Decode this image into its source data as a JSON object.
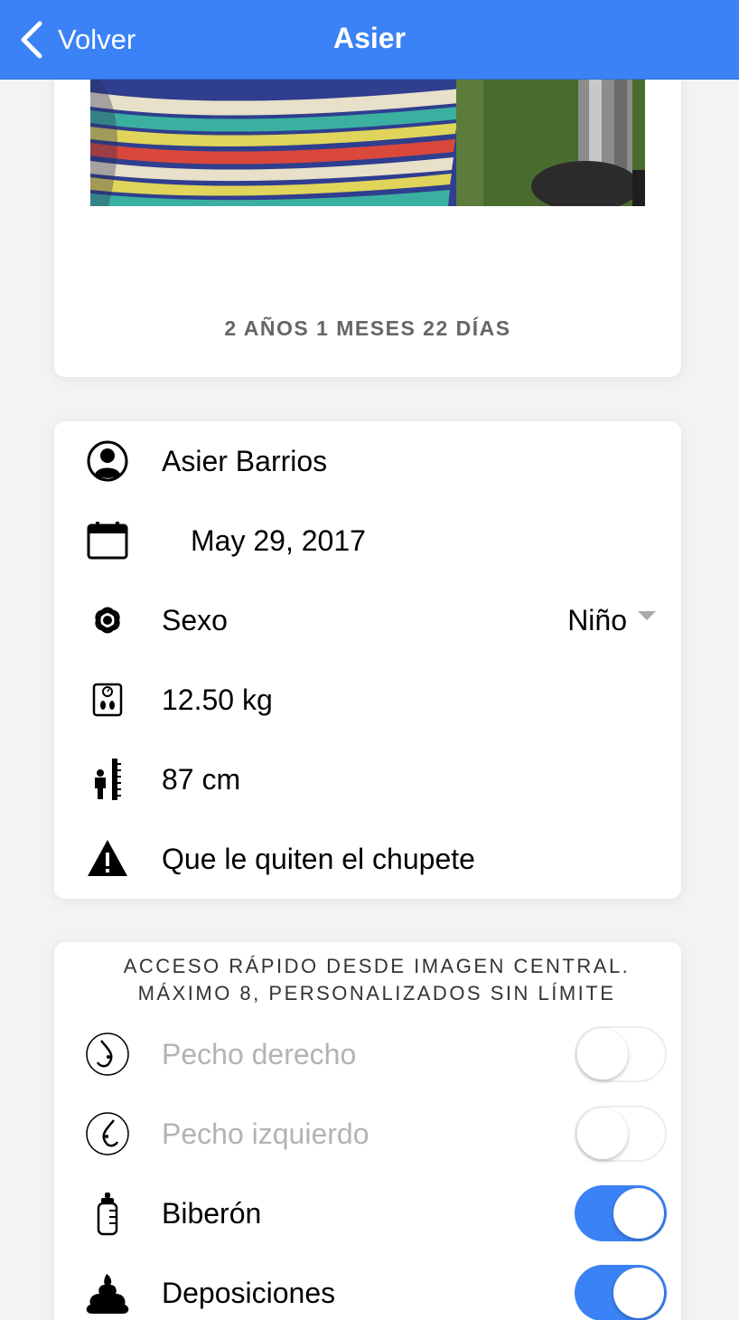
{
  "header": {
    "back_label": "Volver",
    "title": "Asier",
    "color": "#3b82f6"
  },
  "profile": {
    "age": "2 AÑOS 1 MESES 22 DÍAS"
  },
  "info": {
    "name": "Asier Barrios",
    "birthdate": "May 29, 2017",
    "sex_label": "Sexo",
    "sex_value": "Niño",
    "weight": "12.50 kg",
    "height": "87 cm",
    "note": "Que le quiten el chupete"
  },
  "quick_access": {
    "title_line1": "ACCESO RÁPIDO DESDE IMAGEN CENTRAL.",
    "title_line2": "MÁXIMO 8, PERSONALIZADOS SIN LÍMITE",
    "items": [
      {
        "label": "Pecho derecho",
        "icon": "breast-right-icon",
        "enabled": false
      },
      {
        "label": "Pecho izquierdo",
        "icon": "breast-left-icon",
        "enabled": false
      },
      {
        "label": "Biberón",
        "icon": "bottle-icon",
        "enabled": true
      },
      {
        "label": "Deposiciones",
        "icon": "poop-icon",
        "enabled": true
      }
    ]
  }
}
